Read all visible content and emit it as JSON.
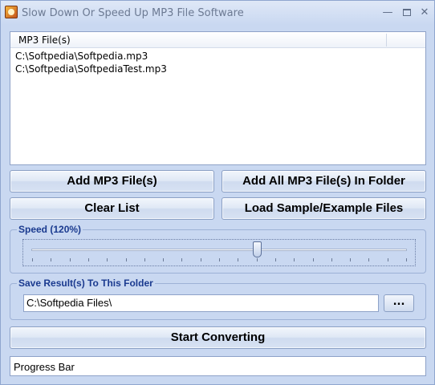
{
  "window": {
    "title": "Slow Down Or Speed Up MP3 File Software",
    "minimize": "—",
    "close": "✕"
  },
  "file_list": {
    "header": "MP3 File(s)",
    "items": [
      "C:\\Softpedia\\Softpedia.mp3",
      "C:\\Softpedia\\SoftpediaTest.mp3"
    ]
  },
  "buttons": {
    "add_files": "Add MP3 File(s)",
    "add_all_in_folder": "Add All MP3 File(s) In Folder",
    "clear_list": "Clear List",
    "load_samples": "Load Sample/Example Files",
    "start_converting": "Start Converting",
    "browse": "..."
  },
  "speed": {
    "label": "Speed (120%)",
    "value_fraction": 0.6
  },
  "output_folder": {
    "label": "Save Result(s) To This Folder",
    "value": "C:\\Softpedia Files\\"
  },
  "progress": {
    "label": "Progress Bar",
    "value_fraction": 0
  },
  "icons": {
    "app": "app-audio-icon",
    "minimize": "minimize-icon",
    "maximize": "maximize-icon",
    "close": "close-icon"
  }
}
